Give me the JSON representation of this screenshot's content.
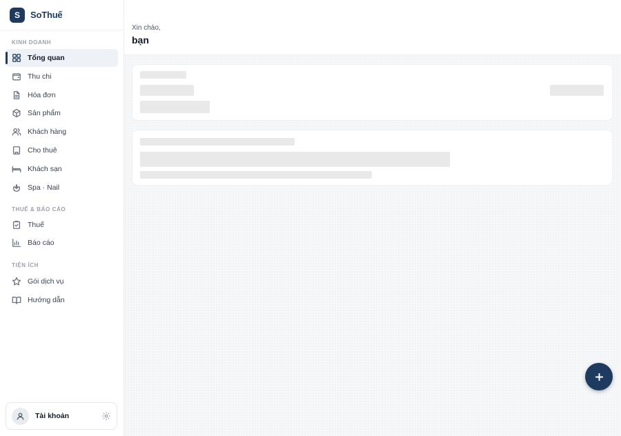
{
  "brand": {
    "logo_letter": "S",
    "name": "SoThuế"
  },
  "sidebar": {
    "sections": [
      {
        "label": "KINH DOANH",
        "items": [
          {
            "label": "Tổng quan",
            "icon": "grid-icon",
            "active": true
          },
          {
            "label": "Thu chi",
            "icon": "wallet-icon"
          },
          {
            "label": "Hóa đơn",
            "icon": "document-icon"
          },
          {
            "label": "Sản phẩm",
            "icon": "box-icon"
          },
          {
            "label": "Khách hàng",
            "icon": "users-icon"
          },
          {
            "label": "Cho thuê",
            "icon": "building-icon"
          },
          {
            "label": "Khách sạn",
            "icon": "bed-icon"
          },
          {
            "label": "Spa · Nail",
            "icon": "flower-icon"
          }
        ]
      },
      {
        "label": "THUẾ & BÁO CÁO",
        "items": [
          {
            "label": "Thuế",
            "icon": "clipboard-check-icon"
          },
          {
            "label": "Báo cáo",
            "icon": "bar-chart-icon"
          }
        ]
      },
      {
        "label": "TIỆN ÍCH",
        "items": [
          {
            "label": "Gói dịch vụ",
            "icon": "star-icon"
          },
          {
            "label": "Hướng dẫn",
            "icon": "book-icon"
          }
        ]
      }
    ]
  },
  "account": {
    "label": "Tài khoản"
  },
  "header": {
    "greeting": "Xin chào,",
    "name": "bạn"
  },
  "colors": {
    "brand": "#1e3a5f",
    "skeleton": "#e9e9ea",
    "active_bg": "#eef2f7"
  }
}
